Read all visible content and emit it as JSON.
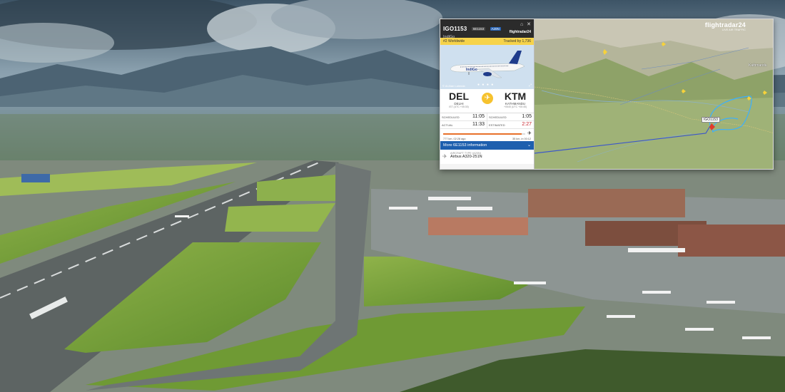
{
  "flight": {
    "callsign": "IGO1153",
    "flight_number": "6E1153",
    "type_code": "A20N",
    "airline": "IndiGo",
    "fr24_mini_logo": "flightradar24",
    "rank": "#2 Worldwide",
    "tracked_by": "Tracked by 1,736",
    "photo_credit": "© Al Alan Lalenda",
    "photo_dots": "● ● ● ●"
  },
  "route": {
    "origin": {
      "code": "DEL",
      "city": "DELHI",
      "tz": "IST (UTC +05:30)"
    },
    "destination": {
      "code": "KTM",
      "city": "KATHMANDU",
      "tz": "+0545 (UTC +05:45)"
    }
  },
  "times": {
    "scheduled_label": "SCHEDULED",
    "actual_label": "ACTUAL",
    "estimated_label": "ESTIMATED",
    "dep_scheduled": "11:05",
    "dep_actual": "11:33",
    "arr_scheduled": "1:05",
    "arr_estimated": "2:27"
  },
  "progress": {
    "fraction": 0.96,
    "left_text": "777 km, 02:28 ago",
    "right_text": "35 km, in 00:12"
  },
  "more_info": "More 6E1153 information",
  "aircraft": {
    "label": "AIRCRAFT TYPE (A20N)",
    "value": "Airbus A320-251N"
  },
  "map": {
    "logo": "flightradar24",
    "logo_sub": "LIVE AIR TRAFFIC",
    "flight_label": "IGO1153",
    "city_label": "Kathmandu"
  },
  "icons": {
    "close": "close-icon",
    "favorite": "home-icon",
    "aircraft_plane": "airplane-icon",
    "chevron": "chevron-down-icon"
  },
  "colors": {
    "accent_blue": "#1d5fae",
    "rank_yellow": "#f6d34a",
    "plane_orange": "#f6c22e",
    "estimated_red": "#c8212b"
  }
}
